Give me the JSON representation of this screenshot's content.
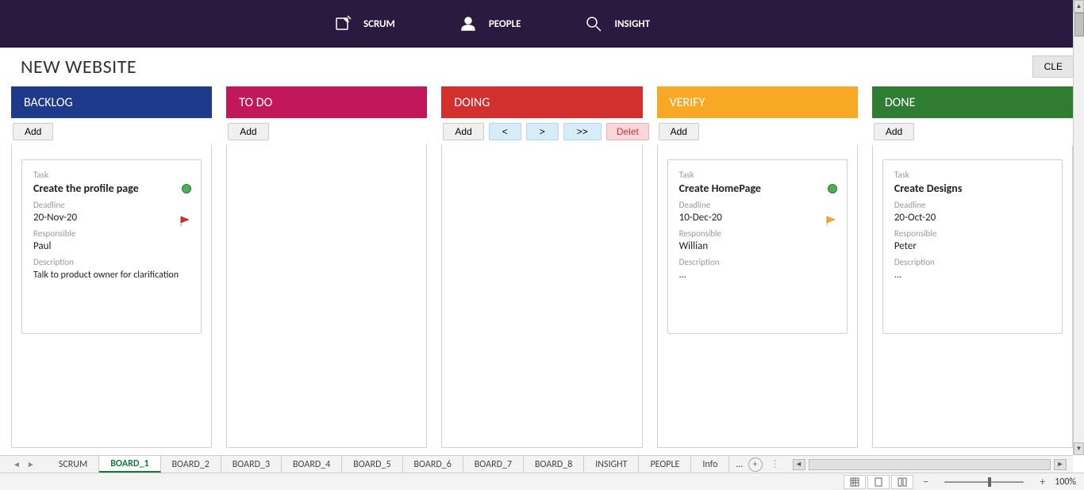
{
  "nav": {
    "scrum": "SCRUM",
    "people": "PEOPLE",
    "insight": "INSIGHT"
  },
  "page_title": "NEW WEBSITE",
  "clear_button": "CLE",
  "columns": {
    "backlog": {
      "title": "BACKLOG",
      "add": "Add"
    },
    "todo": {
      "title": "TO DO",
      "add": "Add"
    },
    "doing": {
      "title": "DOING",
      "add": "Add",
      "prev": "<",
      "next": ">",
      "last": ">>",
      "delete": "Delet"
    },
    "verify": {
      "title": "VERIFY",
      "add": "Add"
    },
    "done": {
      "title": "DONE",
      "add": "Add"
    }
  },
  "labels": {
    "task": "Task",
    "deadline": "Deadline",
    "responsible": "Responsible",
    "description": "Description"
  },
  "cards": {
    "backlog": {
      "title": "Create the profile page",
      "deadline": "20-Nov-20",
      "responsible": "Paul",
      "description": "Talk to product owner for clarification",
      "flag_color": "#d32f2f"
    },
    "verify": {
      "title": "Create HomePage",
      "deadline": "10-Dec-20",
      "responsible": "Willian",
      "description": "...",
      "flag_color": "#f9a825"
    },
    "done": {
      "title": "Create Designs",
      "deadline": "20-Oct-20",
      "responsible": "Peter",
      "description": "..."
    }
  },
  "sheets": {
    "tabs": [
      "SCRUM",
      "BOARD_1",
      "BOARD_2",
      "BOARD_3",
      "BOARD_4",
      "BOARD_5",
      "BOARD_6",
      "BOARD_7",
      "BOARD_8",
      "INSIGHT",
      "PEOPLE",
      "Info"
    ],
    "active": "BOARD_1",
    "more": "..."
  },
  "status": {
    "zoom": "100%"
  }
}
